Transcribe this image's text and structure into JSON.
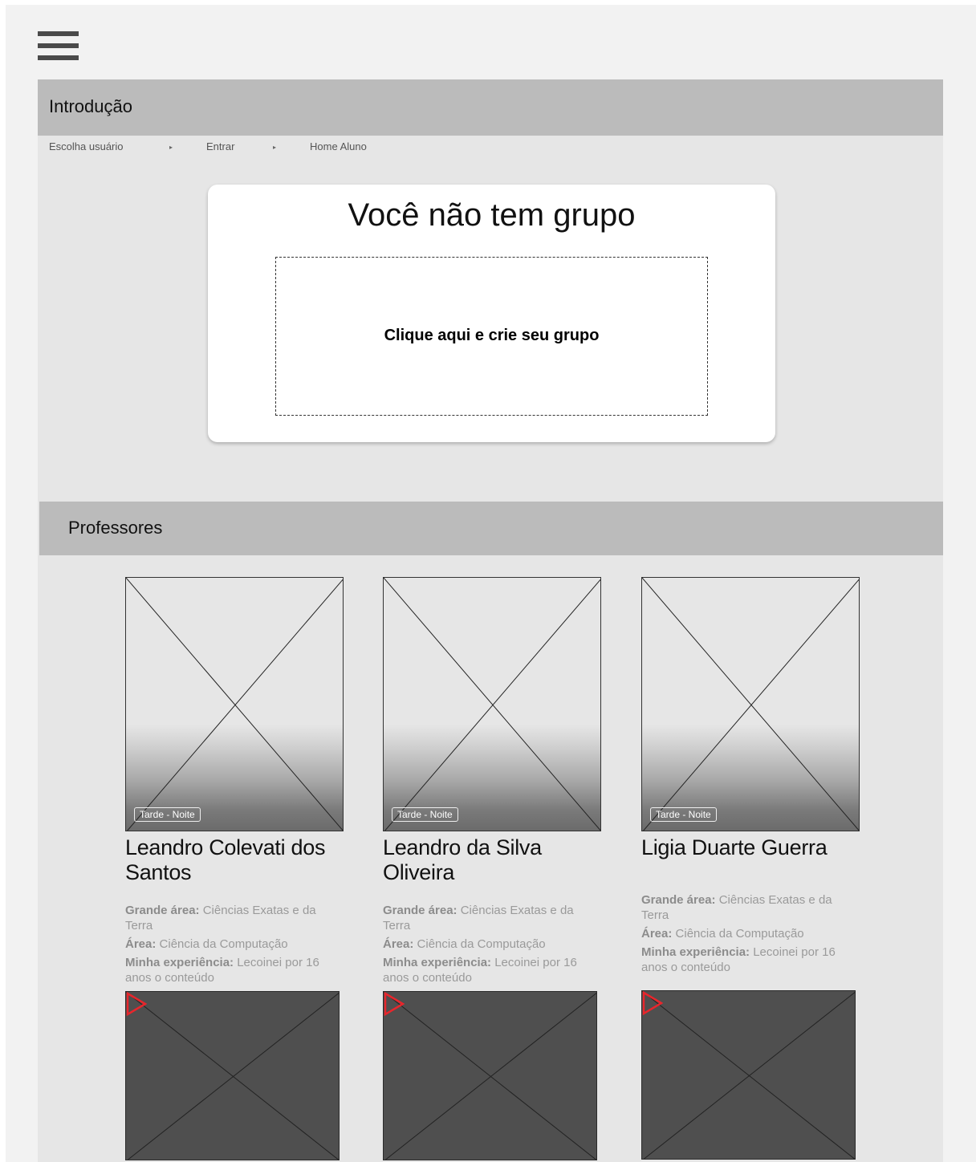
{
  "menu": {
    "icon": "hamburger-menu-icon"
  },
  "intro": {
    "title": "Introdução",
    "breadcrumb": {
      "items": [
        "Escolha usuário",
        "Entrar",
        "Home Aluno"
      ],
      "separator": "▸"
    }
  },
  "group_card": {
    "title": "Você não tem grupo",
    "cta": "Clique aqui e crie seu grupo"
  },
  "professors": {
    "title": "Professores",
    "cards": [
      {
        "period": "Tarde - Noite",
        "name": "Leandro Colevati dos Santos",
        "big_area_label": "Grande área:",
        "big_area": "Ciências Exatas e da Terra",
        "area_label": "Área:",
        "area": "Ciência da Computação",
        "experience_label": "Minha experiência:",
        "experience": "Lecoinei por 16 anos o conteúdo"
      },
      {
        "period": "Tarde - Noite",
        "name": "Leandro da Silva Oliveira",
        "big_area_label": "Grande área:",
        "big_area": "Ciências Exatas e da Terra",
        "area_label": "Área:",
        "area": "Ciência da Computação",
        "experience_label": "Minha experiência:",
        "experience": "Lecoinei por 16 anos o conteúdo"
      },
      {
        "period": "Tarde - Noite",
        "name": "Ligia Duarte Guerra",
        "big_area_label": "Grande área:",
        "big_area": "Ciências Exatas e da Terra",
        "area_label": "Área:",
        "area": "Ciência da Computação",
        "experience_label": "Minha experiência:",
        "experience": "Lecoinei por 16 anos o conteúdo"
      }
    ]
  },
  "colors": {
    "background": "#f2f2f2",
    "panel": "#e6e6e6",
    "header_bar": "#bbbbbb",
    "video_bg": "#4f4f4f",
    "play_icon": "#e8262c"
  }
}
